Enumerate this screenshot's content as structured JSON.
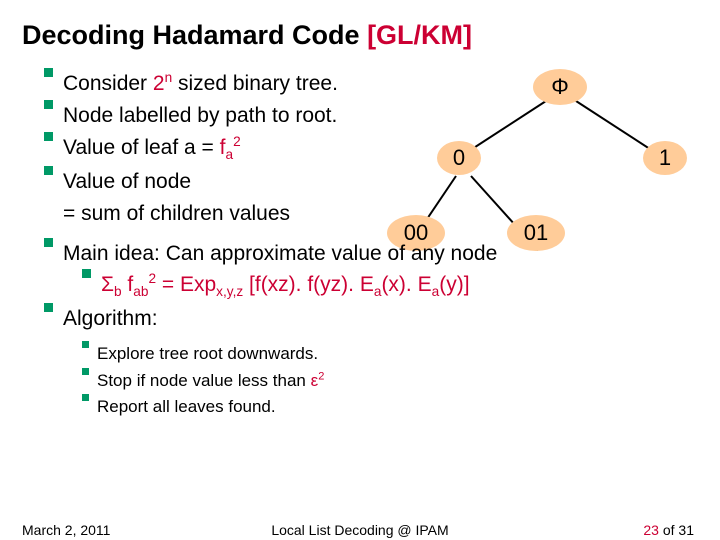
{
  "title": {
    "main": "Decoding Hadamard Code ",
    "ref": "[GL/KM]"
  },
  "bullets": {
    "b1a": "Consider ",
    "b1b": "2",
    "b1c": "n",
    "b1d": " sized binary tree.",
    "b2": "Node labelled by path to root.",
    "b3a": "Value of leaf a = ",
    "b3b": "f",
    "b3c": "a",
    "b3d": "2",
    "b4": "Value of node",
    "b4cont": "= sum of children values",
    "b5": "Main idea: Can approximate value of any node",
    "b5sub_sigma": "Σ",
    "b5sub_b": "b",
    "b5sub_a": " f",
    "b5sub_ab": "ab",
    "b5sub_sq": "2",
    "b5sub_eq": " = Exp",
    "b5sub_expsub": "x,y,z",
    "b5sub_rest_open": " [f(xz). f(yz). E",
    "b5sub_ea1": "a",
    "b5sub_mid": "(x). E",
    "b5sub_ea2": "a",
    "b5sub_close": "(y)]",
    "b6": "Algorithm:",
    "b6a": "Explore tree root downwards.",
    "b6b_a": "Stop if node value less than ",
    "b6b_eps": "ε",
    "b6b_sq": "2",
    "b6c": "Report all leaves found."
  },
  "tree": {
    "root": "Φ",
    "left": "0",
    "right": "1",
    "ll": "00",
    "lr": "01"
  },
  "footer": {
    "date": "March 2, 2011",
    "center": "Local List Decoding @ IPAM",
    "pageNum": "23",
    "pageOf": " of 31"
  }
}
